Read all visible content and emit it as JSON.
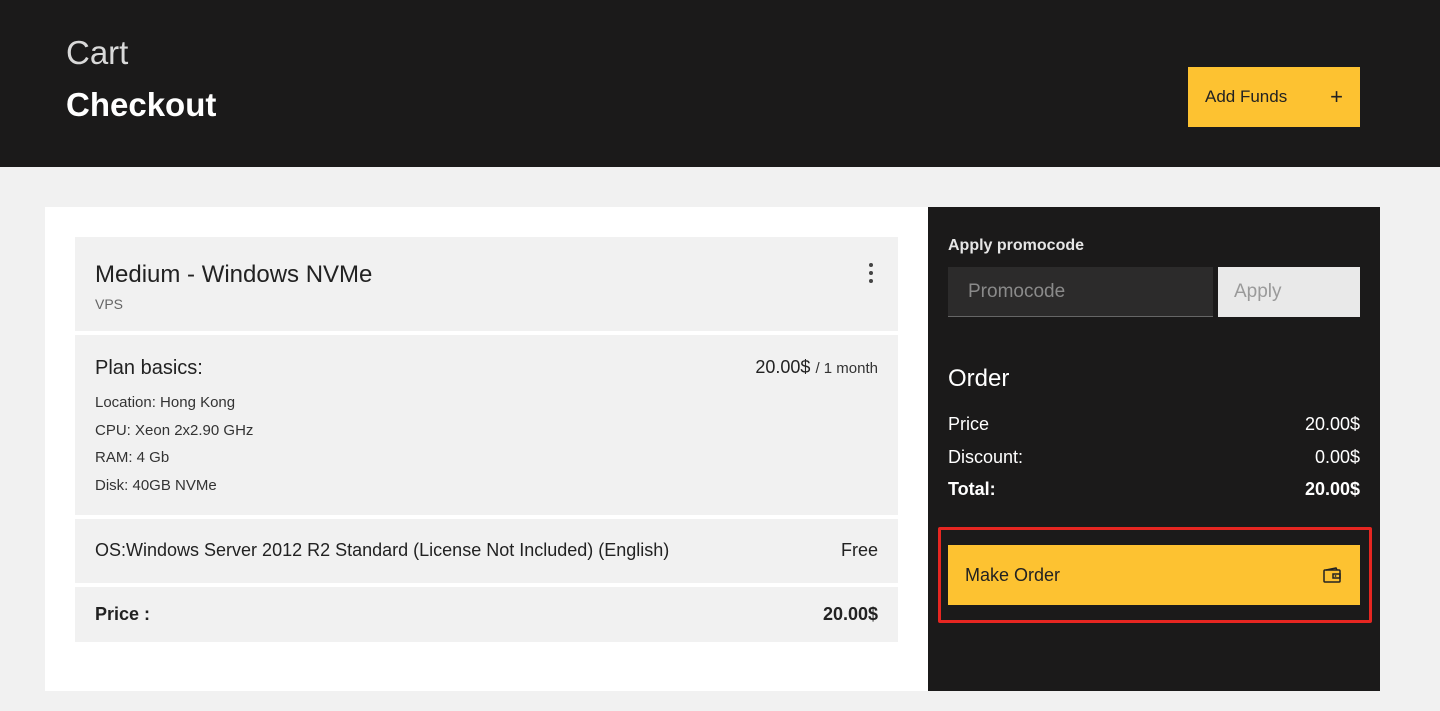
{
  "header": {
    "breadcrumb": "Cart",
    "title": "Checkout",
    "add_funds_label": "Add Funds",
    "add_funds_icon": "plus-icon"
  },
  "product": {
    "name": "Medium - Windows NVMe",
    "type": "VPS",
    "menu_icon": "kebab-menu-icon"
  },
  "plan": {
    "title": "Plan basics:",
    "price": "20.00$",
    "period": "/ 1 month",
    "specs": [
      "Location: Hong Kong",
      "CPU: Xeon 2x2.90 GHz",
      "RAM: 4 Gb",
      "Disk: 40GB NVMe"
    ]
  },
  "os": {
    "label": "OS:",
    "value": "Windows Server 2012 R2 Standard (License Not Included) (English)",
    "price": "Free"
  },
  "price_row": {
    "label": "Price :",
    "value": "20.00$"
  },
  "promo": {
    "label": "Apply promocode",
    "placeholder": "Promocode",
    "apply_label": "Apply"
  },
  "order": {
    "title": "Order",
    "rows": [
      {
        "label": "Price",
        "value": "20.00$"
      },
      {
        "label": "Discount:",
        "value": "0.00$"
      },
      {
        "label": "Total:",
        "value": "20.00$"
      }
    ],
    "make_order_label": "Make Order",
    "make_order_icon": "wallet-icon"
  },
  "colors": {
    "dark": "#1b1a1a",
    "accent": "#fdc231",
    "highlight": "#e62621",
    "background": "#f1f1f1"
  }
}
